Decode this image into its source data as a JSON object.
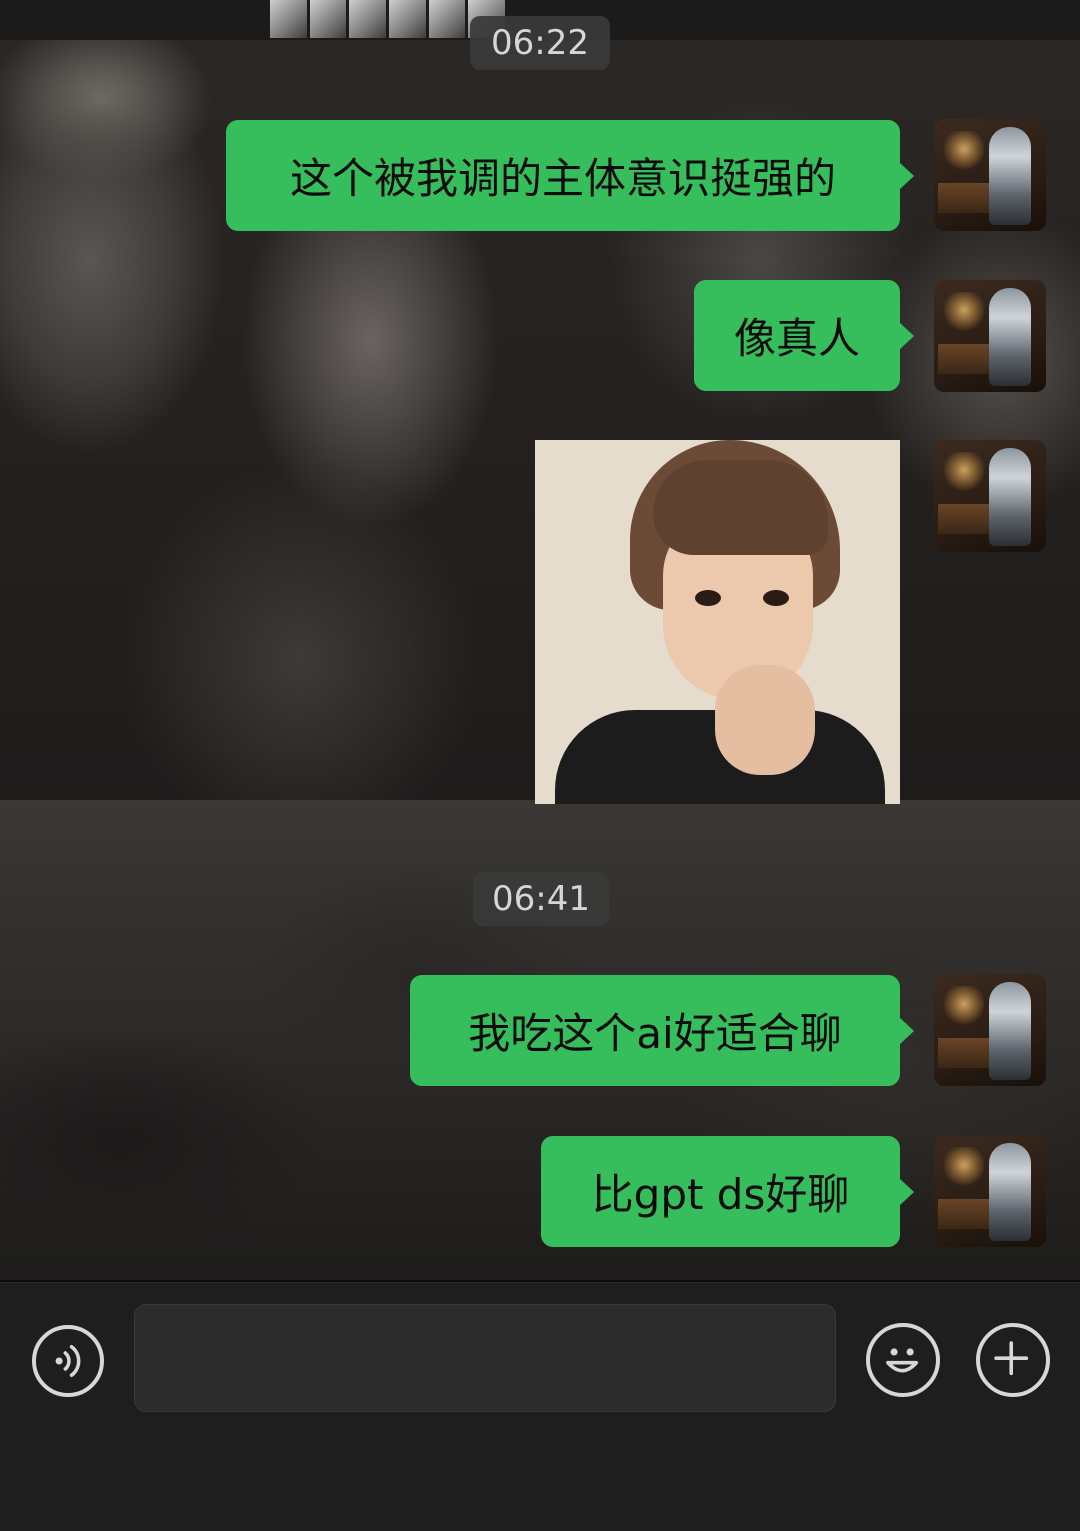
{
  "chat": {
    "timestamps": [
      "06:22",
      "06:41"
    ],
    "messages": [
      {
        "text": "这个被我调的主体意识挺强的"
      },
      {
        "text": "像真人"
      },
      {
        "text": "我吃这个ai好适合聊"
      },
      {
        "text": "比gpt ds好聊"
      }
    ]
  },
  "input_bar": {
    "placeholder": "",
    "voice_icon": "voice-icon",
    "emoji_icon": "emoji-icon",
    "plus_icon": "plus-icon"
  },
  "colors": {
    "bubble": "#36bd5c",
    "input_bar": "#1e1e1e",
    "timestamp_bg": "#3a3a3a"
  }
}
